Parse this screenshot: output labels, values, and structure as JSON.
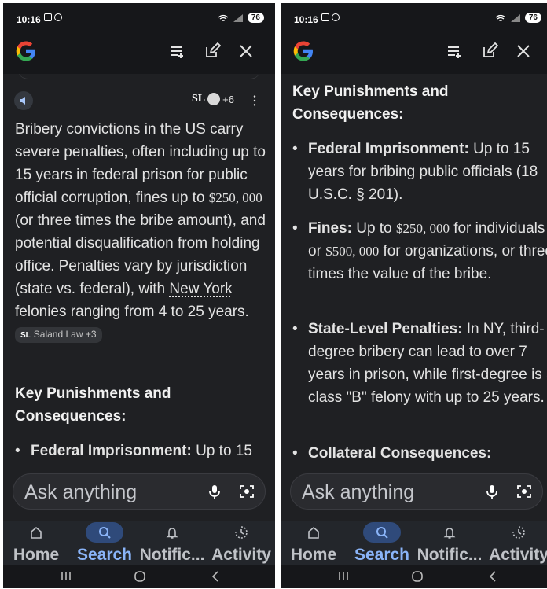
{
  "status_bar": {
    "time": "10:16",
    "battery": "76"
  },
  "left": {
    "sources_count": "+6",
    "source_logo_text": "SL",
    "paragraph": {
      "p1": "Bribery convictions in the US carry severe penalties, often including up to 15 years in federal prison for public official corruption, fines up to ",
      "money": "$250, 000",
      "p2": " (or three times the bribe amount), and potential disqualification from holding office. Penalties vary by jurisdiction (state vs. federal), with ",
      "link": "New York",
      "p3": " felonies ranging from 4 to 25 years. ",
      "chip_prefix": "SL",
      "chip": "Saland Law +3"
    },
    "heading": "Key Punishments and Consequences:",
    "bullet1_bold": "Federal Imprisonment:",
    "bullet1_text": " Up to 15"
  },
  "right": {
    "heading": "Key Punishments and Consequences:",
    "bullets": [
      {
        "bold": "Federal Imprisonment:",
        "text": " Up to 15 years for bribing public officials (18 U.S.C. § 201)."
      },
      {
        "bold": "Fines:",
        "text_a": " Up to ",
        "money_a": "$250, 000",
        "text_b": " for individuals or ",
        "money_b": "$500, 000",
        "text_c": " for organizations, or three times the value of the bribe."
      },
      {
        "bold": "State-Level Penalties:",
        "text": " In NY, third-degree bribery can lead to over 7 years in prison, while first-degree is a class \"B\" felony with up to 25 years."
      },
      {
        "bold": "Collateral Consequences:",
        "text": ""
      }
    ]
  },
  "ask_bar": {
    "placeholder": "Ask anything"
  },
  "nav": {
    "home": "Home",
    "search": "Search",
    "notifications": "Notific...",
    "activity": "Activity"
  },
  "colors": {
    "background": "#1f2023",
    "accent": "#8ab4f8",
    "active_pill": "#2f4a7a"
  }
}
